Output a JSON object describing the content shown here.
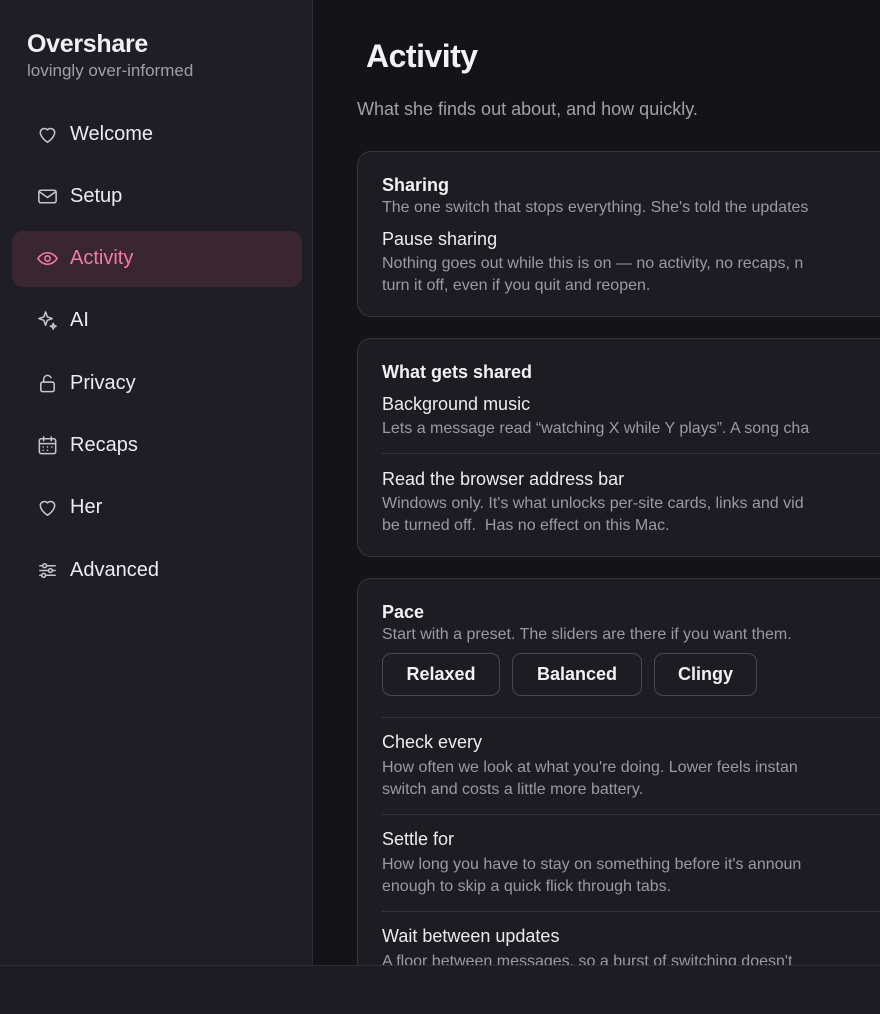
{
  "app": {
    "name": "Overshare",
    "tagline": "lovingly over-informed"
  },
  "sidebar": {
    "items": [
      {
        "label": "Welcome",
        "icon": "heart-icon"
      },
      {
        "label": "Setup",
        "icon": "envelope-icon"
      },
      {
        "label": "Activity",
        "icon": "eye-icon",
        "active": true
      },
      {
        "label": "AI",
        "icon": "sparkles-icon"
      },
      {
        "label": "Privacy",
        "icon": "lock-icon"
      },
      {
        "label": "Recaps",
        "icon": "calendar-icon"
      },
      {
        "label": "Her",
        "icon": "heart-icon"
      },
      {
        "label": "Advanced",
        "icon": "sliders-icon"
      }
    ]
  },
  "page": {
    "title": "Activity",
    "subtitle": "What she finds out about, and how quickly."
  },
  "sharing": {
    "title": "Sharing",
    "desc": "The one switch that stops everything. She's told the updates",
    "pause_title": "Pause sharing",
    "pause_desc": "Nothing goes out while this is on — no activity, no recaps, n\nturn it off, even if you quit and reopen."
  },
  "what_gets_shared": {
    "title": "What gets shared",
    "music_title": "Background music",
    "music_desc": "Lets a message read “watching X while Y plays”. A song cha",
    "browser_title": "Read the browser address bar",
    "browser_desc": "Windows only. It's what unlocks per-site cards, links and vid\nbe turned off.  Has no effect on this Mac."
  },
  "pace": {
    "title": "Pace",
    "desc": "Start with a preset. The sliders are there if you want them.",
    "presets": [
      "Relaxed",
      "Balanced",
      "Clingy"
    ],
    "check_title": "Check every",
    "check_desc": "How often we look at what you're doing. Lower feels instan\nswitch and costs a little more battery.",
    "settle_title": "Settle for",
    "settle_desc": "How long you have to stay on something before it's announ\nenough to skip a quick flick through tabs.",
    "wait_title": "Wait between updates",
    "wait_desc": "A floor between messages, so a burst of switching doesn't"
  },
  "colors": {
    "accent": "#f27aa8",
    "active_bg": "#3a2630",
    "sidebar_bg": "#1f1d25",
    "main_bg": "#141317",
    "card_bg": "#1d1c22"
  }
}
